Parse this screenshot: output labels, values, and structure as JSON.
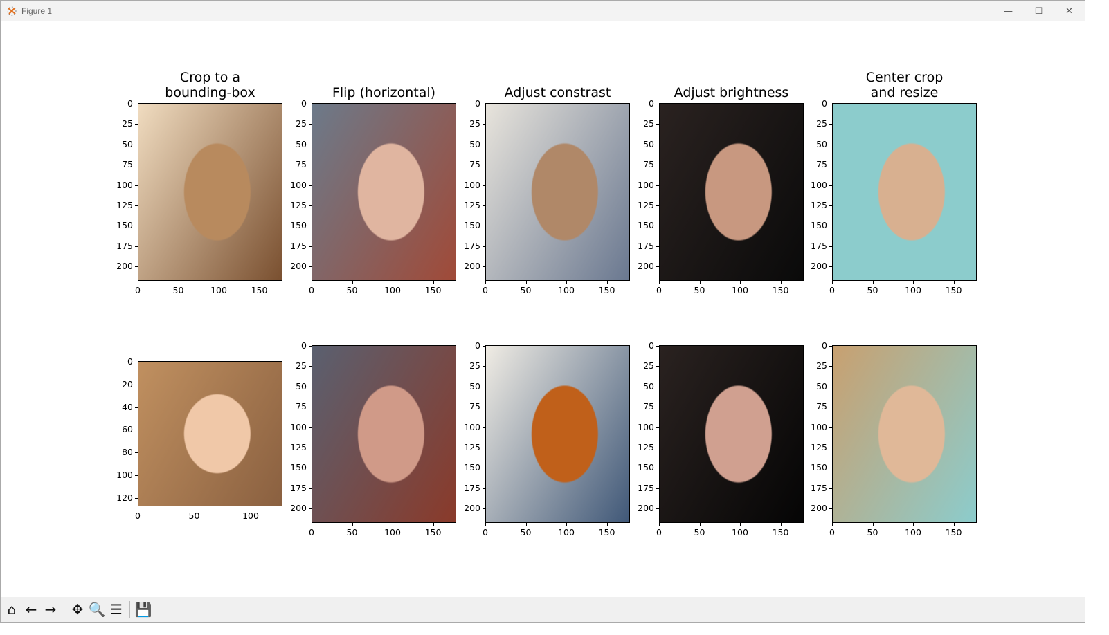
{
  "window": {
    "title": "Figure 1",
    "controls": [
      "minimize",
      "maximize",
      "close"
    ]
  },
  "toolbar": [
    {
      "name": "home-icon",
      "glyph": "⌂"
    },
    {
      "name": "back-icon",
      "glyph": "←"
    },
    {
      "name": "forward-icon",
      "glyph": "→"
    },
    {
      "name": "pan-icon",
      "glyph": "✥"
    },
    {
      "name": "zoom-icon",
      "glyph": "🔍"
    },
    {
      "name": "configure-subplots-icon",
      "glyph": "☰"
    },
    {
      "name": "save-icon",
      "glyph": "💾"
    }
  ],
  "subplots": [
    {
      "title": "Crop to a\nbounding-box",
      "xticks": [
        "0",
        "50",
        "100",
        "150"
      ],
      "yticks": [
        "0",
        "25",
        "50",
        "75",
        "100",
        "125",
        "150",
        "175",
        "200"
      ],
      "colors": [
        "#f0dcc0",
        "#b88a5e",
        "#7a5030"
      ]
    },
    {
      "title": "Flip (horizontal)",
      "xticks": [
        "0",
        "50",
        "100",
        "150"
      ],
      "yticks": [
        "0",
        "25",
        "50",
        "75",
        "100",
        "125",
        "150",
        "175",
        "200"
      ],
      "colors": [
        "#6c7a8a",
        "#e0b5a0",
        "#a04a38"
      ]
    },
    {
      "title": "Adjust constrast",
      "xticks": [
        "0",
        "50",
        "100",
        "150"
      ],
      "yticks": [
        "0",
        "25",
        "50",
        "75",
        "100",
        "125",
        "150",
        "175",
        "200"
      ],
      "colors": [
        "#e8e4dc",
        "#b08868",
        "#6a7890"
      ]
    },
    {
      "title": "Adjust brightness",
      "xticks": [
        "0",
        "50",
        "100",
        "150"
      ],
      "yticks": [
        "0",
        "25",
        "50",
        "75",
        "100",
        "125",
        "150",
        "175",
        "200"
      ],
      "colors": [
        "#2a2220",
        "#c89880",
        "#0a0a0a"
      ]
    },
    {
      "title": "Center crop\nand resize",
      "xticks": [
        "0",
        "50",
        "100",
        "150"
      ],
      "yticks": [
        "0",
        "25",
        "50",
        "75",
        "100",
        "125",
        "150",
        "175",
        "200"
      ],
      "colors": [
        "#8ccccc",
        "#d8b090",
        "#8ccccc"
      ]
    },
    {
      "title": "",
      "xticks": [
        "0",
        "50",
        "100"
      ],
      "yticks": [
        "0",
        "20",
        "40",
        "60",
        "80",
        "100",
        "120"
      ],
      "colors": [
        "#c09060",
        "#f0c8a8",
        "#8a6040"
      ]
    },
    {
      "title": "",
      "xticks": [
        "0",
        "50",
        "100",
        "150"
      ],
      "yticks": [
        "0",
        "25",
        "50",
        "75",
        "100",
        "125",
        "150",
        "175",
        "200"
      ],
      "colors": [
        "#5a6070",
        "#d09a88",
        "#8a3a2a"
      ]
    },
    {
      "title": "",
      "xticks": [
        "0",
        "50",
        "100",
        "150"
      ],
      "yticks": [
        "0",
        "25",
        "50",
        "75",
        "100",
        "125",
        "150",
        "175",
        "200"
      ],
      "colors": [
        "#f0ece4",
        "#c0601a",
        "#405878"
      ]
    },
    {
      "title": "",
      "xticks": [
        "0",
        "50",
        "100",
        "150"
      ],
      "yticks": [
        "0",
        "25",
        "50",
        "75",
        "100",
        "125",
        "150",
        "175",
        "200"
      ],
      "colors": [
        "#2a2220",
        "#d0a090",
        "#050505"
      ]
    },
    {
      "title": "",
      "xticks": [
        "0",
        "50",
        "100",
        "150"
      ],
      "yticks": [
        "0",
        "25",
        "50",
        "75",
        "100",
        "125",
        "150",
        "175",
        "200"
      ],
      "colors": [
        "#c8a070",
        "#e0b898",
        "#8ccccc"
      ]
    }
  ]
}
